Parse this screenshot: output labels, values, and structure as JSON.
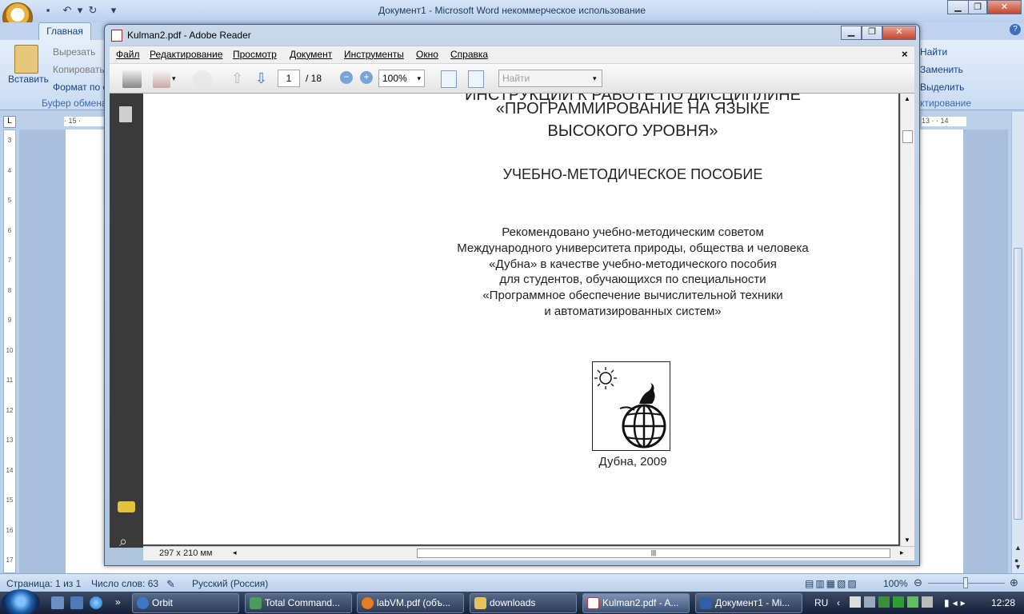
{
  "word": {
    "title": "Документ1 - Microsoft Word некоммерческое использование",
    "tabs": [
      "Главная"
    ],
    "clipboard": {
      "paste": "Вставить",
      "cut": "Вырезать",
      "copy": "Копировать",
      "format_painter": "Формат по образцу",
      "group": "Буфер обмена"
    },
    "editing": {
      "find": "Найти",
      "replace": "Заменить",
      "select": "Выделить",
      "group": "Редактирование"
    },
    "ruler_left": "· 15 ·",
    "ruler_right": "13 · · 14",
    "vruler_numbers": [
      "3",
      "4",
      "5",
      "6",
      "7",
      "8",
      "9",
      "10",
      "11",
      "12",
      "13",
      "14",
      "15",
      "16",
      "17"
    ],
    "status": {
      "page": "Страница: 1 из 1",
      "words": "Число слов: 63",
      "language": "Русский (Россия)",
      "zoom": "100%"
    }
  },
  "reader": {
    "title": "Kulman2.pdf - Adobe Reader",
    "menu": [
      "Файл",
      "Редактирование",
      "Просмотр",
      "Документ",
      "Инструменты",
      "Окно",
      "Справка"
    ],
    "page_current": "1",
    "page_total": "/ 18",
    "zoom": "100%",
    "find_placeholder": "Найти",
    "page_size": "297 x 210 мм",
    "pdf": {
      "partial_line": "ИНСТРУКЦИИ К РАБОТЕ ПО ДИСЦИПЛИНЕ",
      "title_line1": "«ПРОГРАММИРОВАНИЕ НА ЯЗЫКЕ",
      "title_line2": "ВЫСОКОГО УРОВНЯ»",
      "subtitle": "УЧЕБНО-МЕТОДИЧЕСКОЕ ПОСОБИЕ",
      "recommended": [
        "Рекомендовано учебно-методическим советом",
        "Международного университета природы, общества и человека",
        "«Дубна» в качестве учебно-методического пособия",
        "для студентов, обучающихся по специальности",
        "«Программное обеспечение вычислительной техники",
        "и автоматизированных систем»"
      ],
      "footer": "Дубна, 2009"
    }
  },
  "taskbar": {
    "items": [
      "Orbit",
      "Total Command...",
      "labVM.pdf (объ...",
      "downloads",
      "Kulman2.pdf - A...",
      "Документ1 - Mi..."
    ],
    "lang": "RU",
    "clock": "12:28"
  }
}
